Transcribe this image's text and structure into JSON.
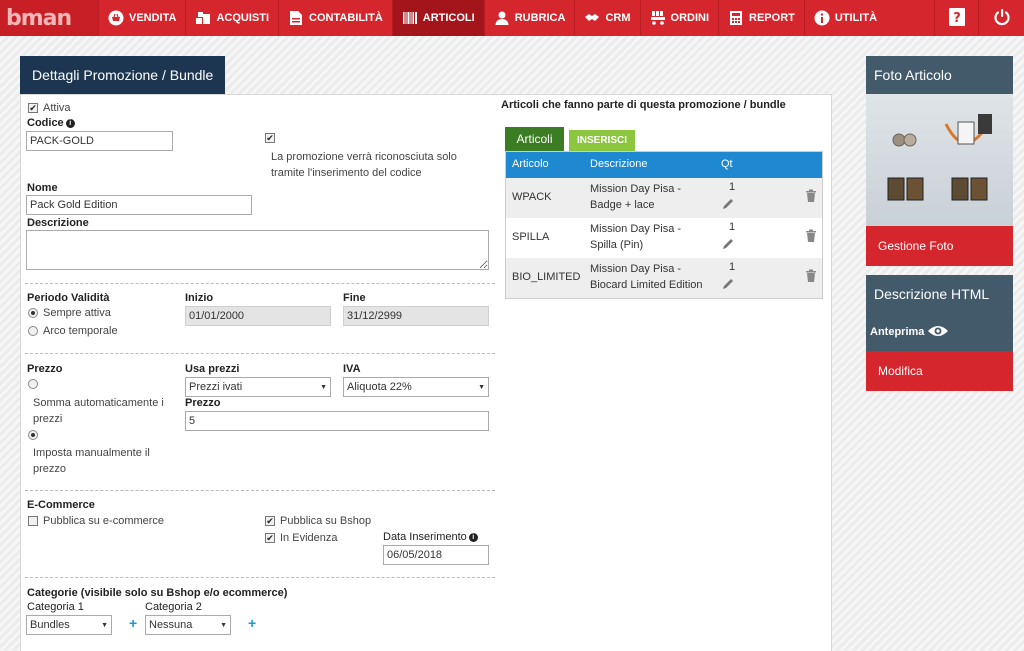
{
  "app": {
    "logo": "bman"
  },
  "nav": {
    "items": [
      {
        "label": "VENDITA",
        "icon": "basket-icon"
      },
      {
        "label": "ACQUISTI",
        "icon": "boxes-icon"
      },
      {
        "label": "CONTABILITÀ",
        "icon": "document-icon"
      },
      {
        "label": "ARTICOLI",
        "icon": "barcode-icon",
        "active": true
      },
      {
        "label": "RUBRICA",
        "icon": "user-icon"
      },
      {
        "label": "CRM",
        "icon": "handshake-icon"
      },
      {
        "label": "ORDINI",
        "icon": "cart-icon"
      },
      {
        "label": "REPORT",
        "icon": "calculator-icon"
      },
      {
        "label": "UTILITÀ",
        "icon": "info-icon"
      }
    ],
    "right": [
      "help-icon",
      "power-icon"
    ]
  },
  "panel": {
    "title": "Dettagli Promozione / Bundle",
    "attiva_label": "Attiva",
    "codice_label": "Codice",
    "codice_value": "PACK-GOLD",
    "code_note": "La promozione verrà riconosciuta solo tramite l'inserimento del codice",
    "nome_label": "Nome",
    "nome_value": "Pack Gold Edition",
    "descrizione_label": "Descrizione",
    "descrizione_value": "",
    "periodo": {
      "label": "Periodo Validità",
      "opt1": "Sempre attiva",
      "opt2": "Arco temporale",
      "inizio_label": "Inizio",
      "inizio_value": "01/01/2000",
      "fine_label": "Fine",
      "fine_value": "31/12/2999"
    },
    "prezzo": {
      "label": "Prezzo",
      "opt1": "Somma automaticamente i prezzi",
      "opt2": "Imposta manualmente il prezzo",
      "usa_label": "Usa prezzi",
      "usa_value": "Prezzi ivati",
      "iva_label": "IVA",
      "iva_value": "Aliquota 22%",
      "prezzo_label": "Prezzo",
      "prezzo_value": "5"
    },
    "ecommerce": {
      "label": "E-Commerce",
      "pubblica_ecom": "Pubblica su e-commerce",
      "pubblica_bshop": "Pubblica su Bshop",
      "evidenza": "In Evidenza",
      "data_label": "Data Inserimento",
      "data_value": "06/05/2018"
    },
    "categorie": {
      "label": "Categorie (visibile solo su Bshop e/o ecommerce)",
      "cat1_label": "Categoria 1",
      "cat1_value": "Bundles",
      "cat2_label": "Categoria 2",
      "cat2_value": "Nessuna"
    }
  },
  "articles": {
    "heading": "Articoli che fanno parte di questa promozione / bundle",
    "tab_articoli": "Articoli",
    "tab_inserisci": "INSERISCI",
    "columns": [
      "Articolo",
      "Descrizione",
      "Qt"
    ],
    "rows": [
      {
        "code": "WPACK",
        "desc1": "Mission Day Pisa -",
        "desc2": "Badge + lace",
        "qty": "1"
      },
      {
        "code": "SPILLA",
        "desc1": "Mission Day Pisa -",
        "desc2": "Spilla (Pin)",
        "qty": "1"
      },
      {
        "code": "BIO_LIMITED",
        "desc1": "Mission Day Pisa -",
        "desc2": "Biocard Limited Edition",
        "qty": "1"
      }
    ]
  },
  "sidebar": {
    "foto_title": "Foto Articolo",
    "gestione_foto": "Gestione Foto",
    "desc_title": "Descrizione HTML",
    "anteprima": "Anteprima",
    "modifica": "Modifica"
  }
}
